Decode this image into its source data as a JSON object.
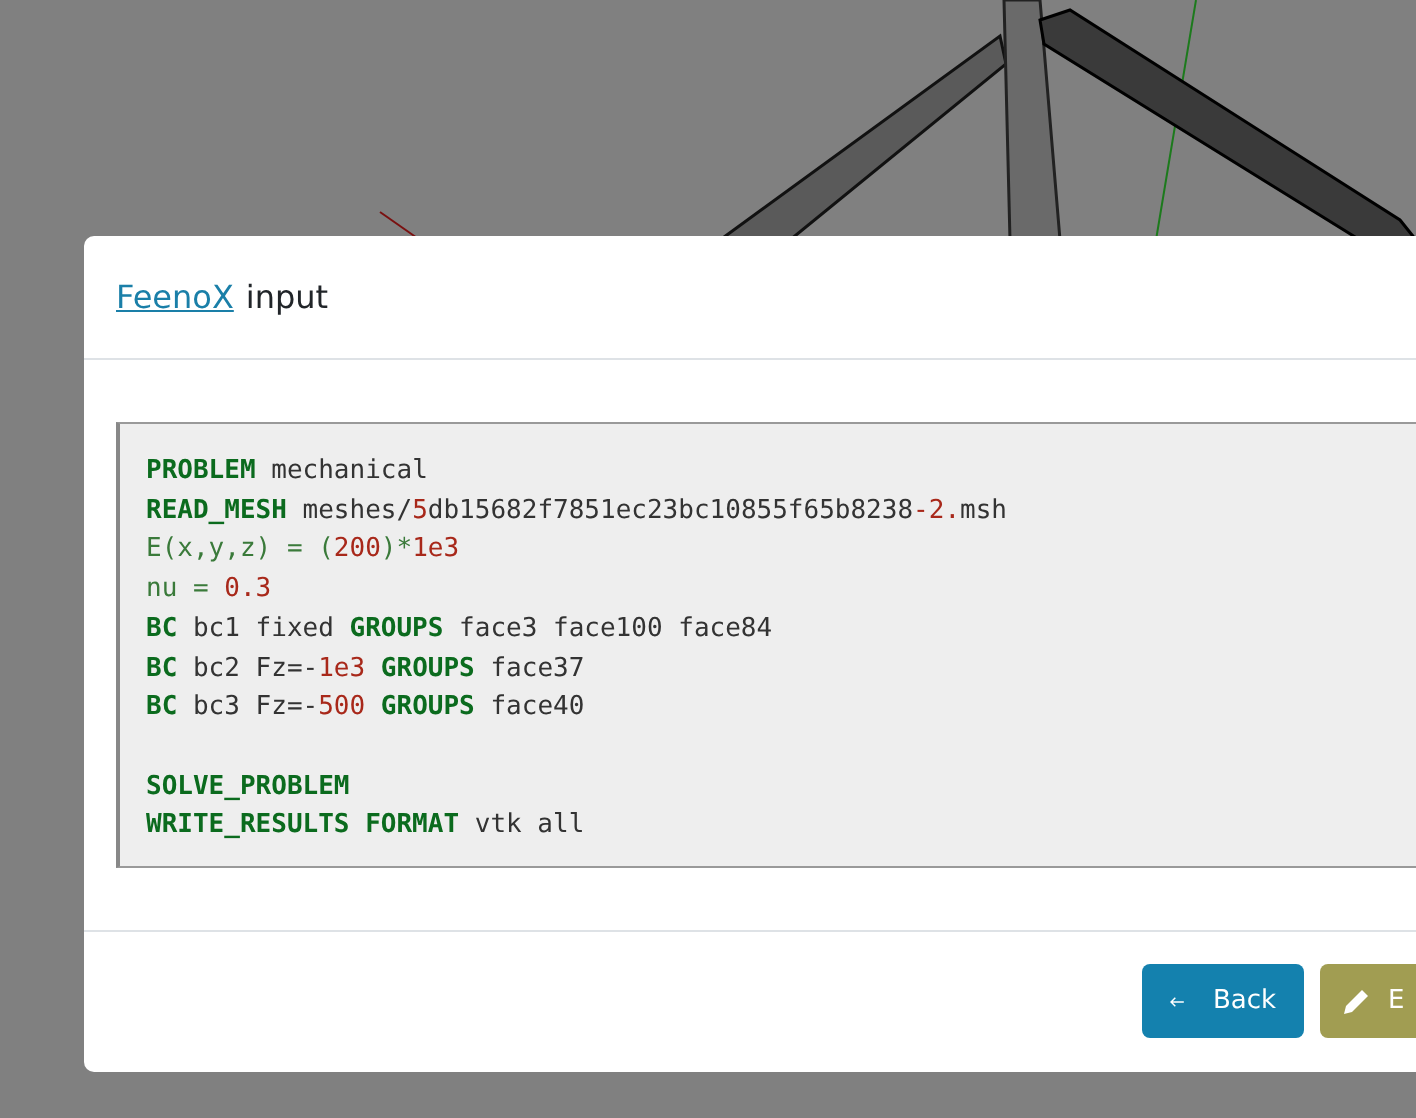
{
  "dialog": {
    "title": {
      "link": "FeenoX",
      "text": "input"
    },
    "code": [
      {
        "tokens": [
          {
            "text": "PROBLEM",
            "kind": "keyword"
          },
          {
            "text": " mechanical",
            "kind": "plain"
          }
        ]
      },
      {
        "tokens": [
          {
            "text": "READ_MESH",
            "kind": "keyword"
          },
          {
            "text": " meshes/",
            "kind": "plain"
          },
          {
            "text": "5",
            "kind": "number"
          },
          {
            "text": "db15682f7851ec23bc10855f65b8238",
            "kind": "plain"
          },
          {
            "text": "-2.",
            "kind": "number"
          },
          {
            "text": "msh",
            "kind": "plain"
          }
        ]
      },
      {
        "tokens": [
          {
            "text": "E(x,y,z) = (",
            "kind": "expression"
          },
          {
            "text": "200",
            "kind": "number"
          },
          {
            "text": ")*",
            "kind": "expression"
          },
          {
            "text": "1e3",
            "kind": "number"
          }
        ]
      },
      {
        "tokens": [
          {
            "text": "nu = ",
            "kind": "expression"
          },
          {
            "text": "0.3",
            "kind": "number"
          }
        ]
      },
      {
        "tokens": [
          {
            "text": "BC",
            "kind": "keyword"
          },
          {
            "text": " bc1 fixed ",
            "kind": "plain"
          },
          {
            "text": "GROUPS",
            "kind": "keyword"
          },
          {
            "text": " face3 face100 face84",
            "kind": "plain"
          }
        ]
      },
      {
        "tokens": [
          {
            "text": "BC",
            "kind": "keyword"
          },
          {
            "text": " bc2 Fz=-",
            "kind": "plain"
          },
          {
            "text": "1e3",
            "kind": "number"
          },
          {
            "text": " GROUPS",
            "kind": "keyword"
          },
          {
            "text": " face37",
            "kind": "plain"
          }
        ]
      },
      {
        "tokens": [
          {
            "text": "BC",
            "kind": "keyword"
          },
          {
            "text": " bc3 Fz=-",
            "kind": "plain"
          },
          {
            "text": "500",
            "kind": "number"
          },
          {
            "text": " GROUPS",
            "kind": "keyword"
          },
          {
            "text": " face40",
            "kind": "plain"
          }
        ]
      },
      {
        "blank_before": true,
        "tokens": [
          {
            "text": "SOLVE_PROBLEM",
            "kind": "keyword"
          }
        ]
      },
      {
        "tokens": [
          {
            "text": "WRITE_RESULTS",
            "kind": "keyword"
          },
          {
            "text": " FORMAT",
            "kind": "keyword"
          },
          {
            "text": " vtk all",
            "kind": "plain"
          }
        ]
      }
    ],
    "buttons": [
      {
        "label": "Back",
        "kind": "back"
      },
      {
        "label": "E",
        "kind": "edit"
      }
    ]
  }
}
